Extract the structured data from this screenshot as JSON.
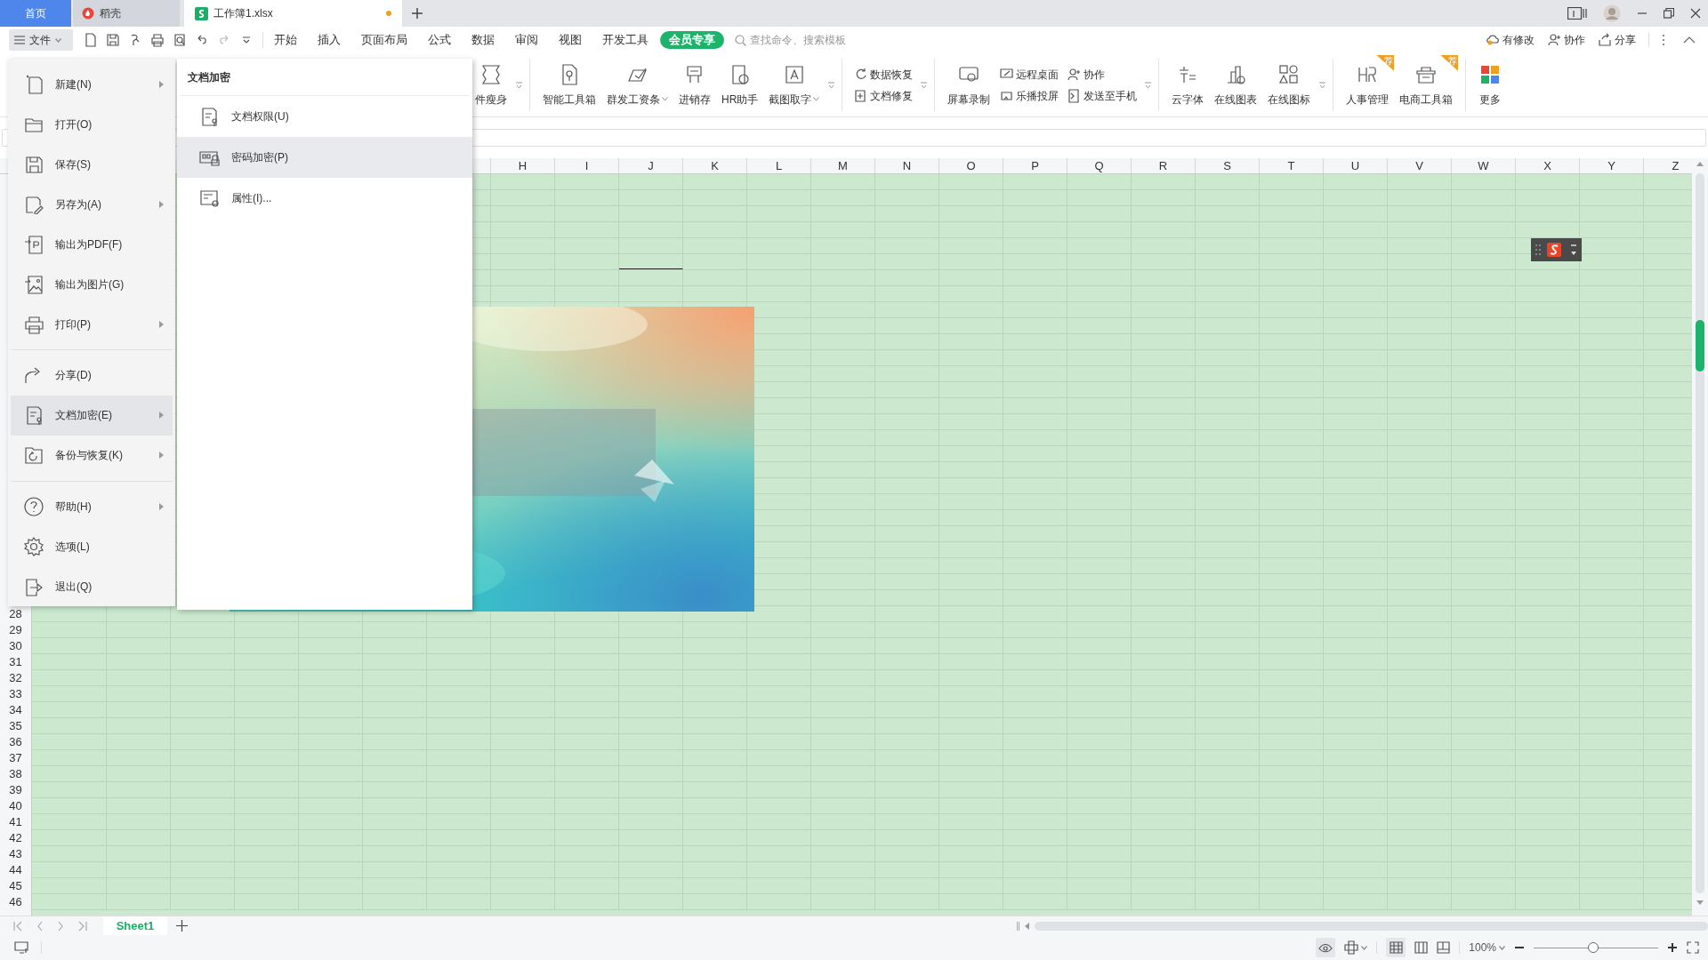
{
  "tabs": [
    {
      "label": "首页",
      "kind": "home",
      "selected": false,
      "modified": false
    },
    {
      "label": "稻壳",
      "kind": "docer",
      "selected": false,
      "modified": false
    },
    {
      "label": "工作簿1.xlsx",
      "kind": "sheet",
      "selected": true,
      "modified": true
    }
  ],
  "file_button": "文件",
  "menu_tabs": [
    {
      "label": "开始",
      "kind": "plain"
    },
    {
      "label": "插入",
      "kind": "plain"
    },
    {
      "label": "页面布局",
      "kind": "plain"
    },
    {
      "label": "公式",
      "kind": "plain"
    },
    {
      "label": "数据",
      "kind": "plain"
    },
    {
      "label": "审阅",
      "kind": "plain"
    },
    {
      "label": "视图",
      "kind": "plain"
    },
    {
      "label": "开发工具",
      "kind": "plain"
    },
    {
      "label": "会员专享",
      "kind": "member"
    }
  ],
  "search": {
    "placeholder": "查找命令、搜索模板"
  },
  "header_actions": [
    "有修改",
    "协作",
    "分享"
  ],
  "ribbon": [
    {
      "expander": true,
      "items": [
        {
          "kind": "big",
          "label": "件瘦身",
          "caret": false
        }
      ]
    },
    {
      "expander": true,
      "items": [
        {
          "kind": "big",
          "label": "智能工具箱",
          "caret": false
        },
        {
          "kind": "big",
          "label": "群发工资条",
          "caret": true
        },
        {
          "kind": "big",
          "label": "进销存",
          "caret": false
        },
        {
          "kind": "big",
          "label": "HR助手",
          "caret": false
        },
        {
          "kind": "big",
          "label": "截图取字",
          "caret": true
        }
      ]
    },
    {
      "expander": true,
      "items": [
        {
          "kind": "stack",
          "items": [
            "数据恢复",
            "文档修复"
          ]
        }
      ]
    },
    {
      "expander": true,
      "items": [
        {
          "kind": "big",
          "label": "屏幕录制",
          "caret": false
        },
        {
          "kind": "stack",
          "items": [
            "远程桌面",
            "乐播投屏"
          ]
        },
        {
          "kind": "stack",
          "items": [
            "协作",
            "发送至手机"
          ]
        }
      ]
    },
    {
      "expander": true,
      "items": [
        {
          "kind": "big",
          "label": "云字体",
          "caret": false
        },
        {
          "kind": "big",
          "label": "在线图表",
          "caret": false
        },
        {
          "kind": "big",
          "label": "在线图标",
          "caret": false
        }
      ]
    },
    {
      "items": [
        {
          "kind": "big",
          "label": "人事管理",
          "badge": "荐"
        },
        {
          "kind": "big",
          "label": "电商工具箱",
          "badge": "荐"
        }
      ]
    },
    {
      "items": [
        {
          "kind": "big",
          "label": "更多"
        }
      ]
    }
  ],
  "columns": [
    "H",
    "I",
    "J",
    "K",
    "L",
    "M",
    "N",
    "O",
    "P",
    "Q",
    "R",
    "S",
    "T",
    "U",
    "V",
    "W",
    "X",
    "Y",
    "Z"
  ],
  "rows": [
    "28",
    "29",
    "30",
    "31",
    "32",
    "33",
    "34",
    "35",
    "36",
    "37",
    "38",
    "39",
    "40",
    "41",
    "42",
    "43",
    "44",
    "45",
    "46"
  ],
  "file_menu": [
    [
      {
        "label": "新建(N)",
        "submenu": true,
        "selected": false
      },
      {
        "label": "打开(O)",
        "submenu": false,
        "selected": false
      },
      {
        "label": "保存(S)",
        "submenu": false,
        "selected": false
      },
      {
        "label": "另存为(A)",
        "submenu": true,
        "selected": false
      },
      {
        "label": "输出为PDF(F)",
        "submenu": false,
        "selected": false
      },
      {
        "label": "输出为图片(G)",
        "submenu": false,
        "selected": false
      },
      {
        "label": "打印(P)",
        "submenu": true,
        "selected": false
      }
    ],
    [
      {
        "label": "分享(D)",
        "submenu": false,
        "selected": false
      },
      {
        "label": "文档加密(E)",
        "submenu": true,
        "selected": true
      },
      {
        "label": "备份与恢复(K)",
        "submenu": true,
        "selected": false
      }
    ],
    [
      {
        "label": "帮助(H)",
        "submenu": true,
        "selected": false
      },
      {
        "label": "选项(L)",
        "submenu": false,
        "selected": false
      },
      {
        "label": "退出(Q)",
        "submenu": false,
        "selected": false
      }
    ]
  ],
  "submenu": {
    "title": "文档加密",
    "items": [
      {
        "label": "文档权限(U)",
        "selected": false
      },
      {
        "label": "密码加密(P)",
        "selected": true
      },
      {
        "label": "属性(I)...",
        "selected": false
      }
    ]
  },
  "sheet_tabs": [
    {
      "label": "Sheet1",
      "selected": true
    }
  ],
  "status": {
    "zoom": "100%",
    "zoom_slider": {
      "level": 0.48
    }
  }
}
